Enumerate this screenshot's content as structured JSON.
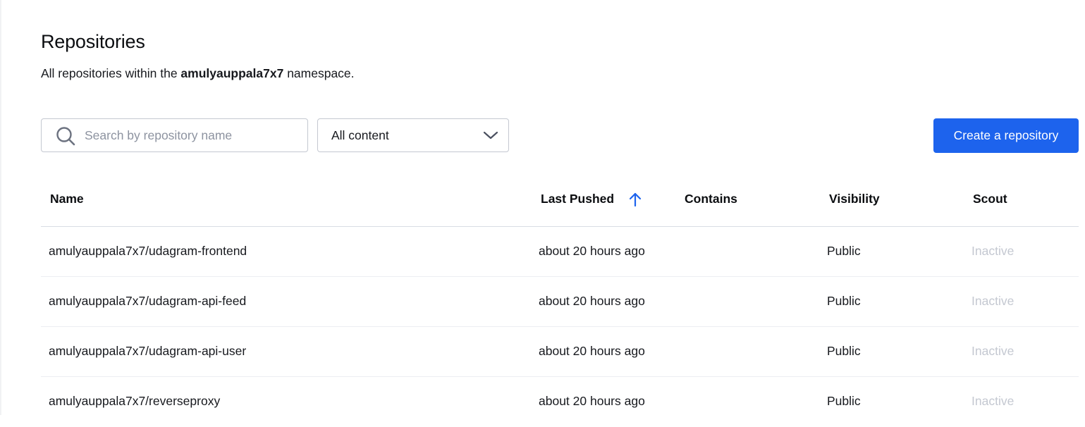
{
  "page": {
    "title": "Repositories",
    "subtitle_prefix": "All repositories within the ",
    "namespace": "amulyauppala7x7",
    "subtitle_suffix": " namespace."
  },
  "toolbar": {
    "search_placeholder": "Search by repository name",
    "search_value": "",
    "search_icon": "search-icon",
    "filter_selected": "All content",
    "filter_icon": "chevron-down-icon",
    "create_label": "Create a repository"
  },
  "table": {
    "columns": [
      "Name",
      "Last Pushed",
      "Contains",
      "Visibility",
      "Scout"
    ],
    "sorted_column": "Last Pushed",
    "sort_icon": "arrow-up-icon",
    "rows": [
      {
        "name": "amulyauppala7x7/udagram-frontend",
        "last_pushed": "about 20 hours ago",
        "contains": "",
        "visibility": "Public",
        "scout": "Inactive"
      },
      {
        "name": "amulyauppala7x7/udagram-api-feed",
        "last_pushed": "about 20 hours ago",
        "contains": "",
        "visibility": "Public",
        "scout": "Inactive"
      },
      {
        "name": "amulyauppala7x7/udagram-api-user",
        "last_pushed": "about 20 hours ago",
        "contains": "",
        "visibility": "Public",
        "scout": "Inactive"
      },
      {
        "name": "amulyauppala7x7/reverseproxy",
        "last_pushed": "about 20 hours ago",
        "contains": "",
        "visibility": "Public",
        "scout": "Inactive"
      }
    ]
  },
  "colors": {
    "accent": "#1d63ed",
    "inactive_text": "#c4c8d1",
    "border": "#c4c8d1"
  }
}
